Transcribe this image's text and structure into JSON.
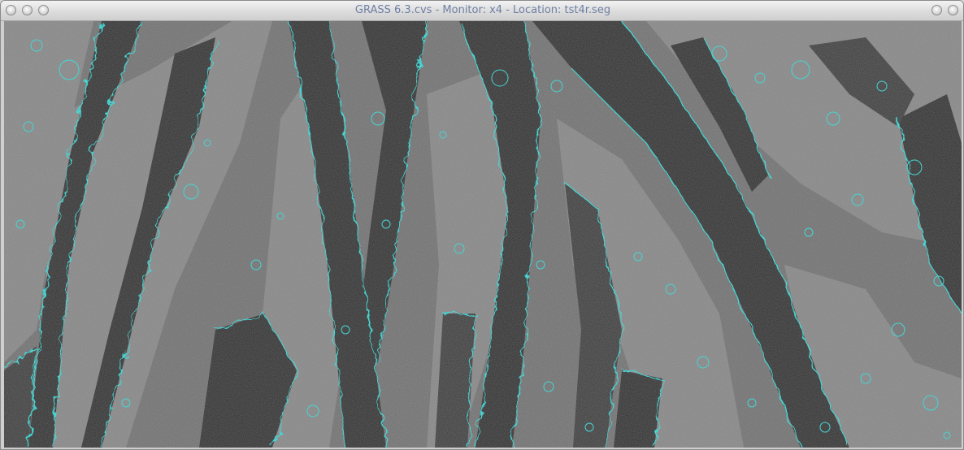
{
  "window": {
    "title": "GRASS 6.3.cvs - Monitor: x4 - Location: tst4r.seg",
    "left_buttons": [
      "close-icon",
      "minimize-icon",
      "maximize-icon"
    ],
    "right_buttons": [
      "shade-icon",
      "close-icon"
    ]
  },
  "map": {
    "description_icon": "raster-map",
    "colors": {
      "background": "#4b4b4b",
      "light_terrain": "#7e7e7e",
      "dark_channel": "#2f2f2f",
      "segment_outline": "#46d6d4"
    }
  }
}
